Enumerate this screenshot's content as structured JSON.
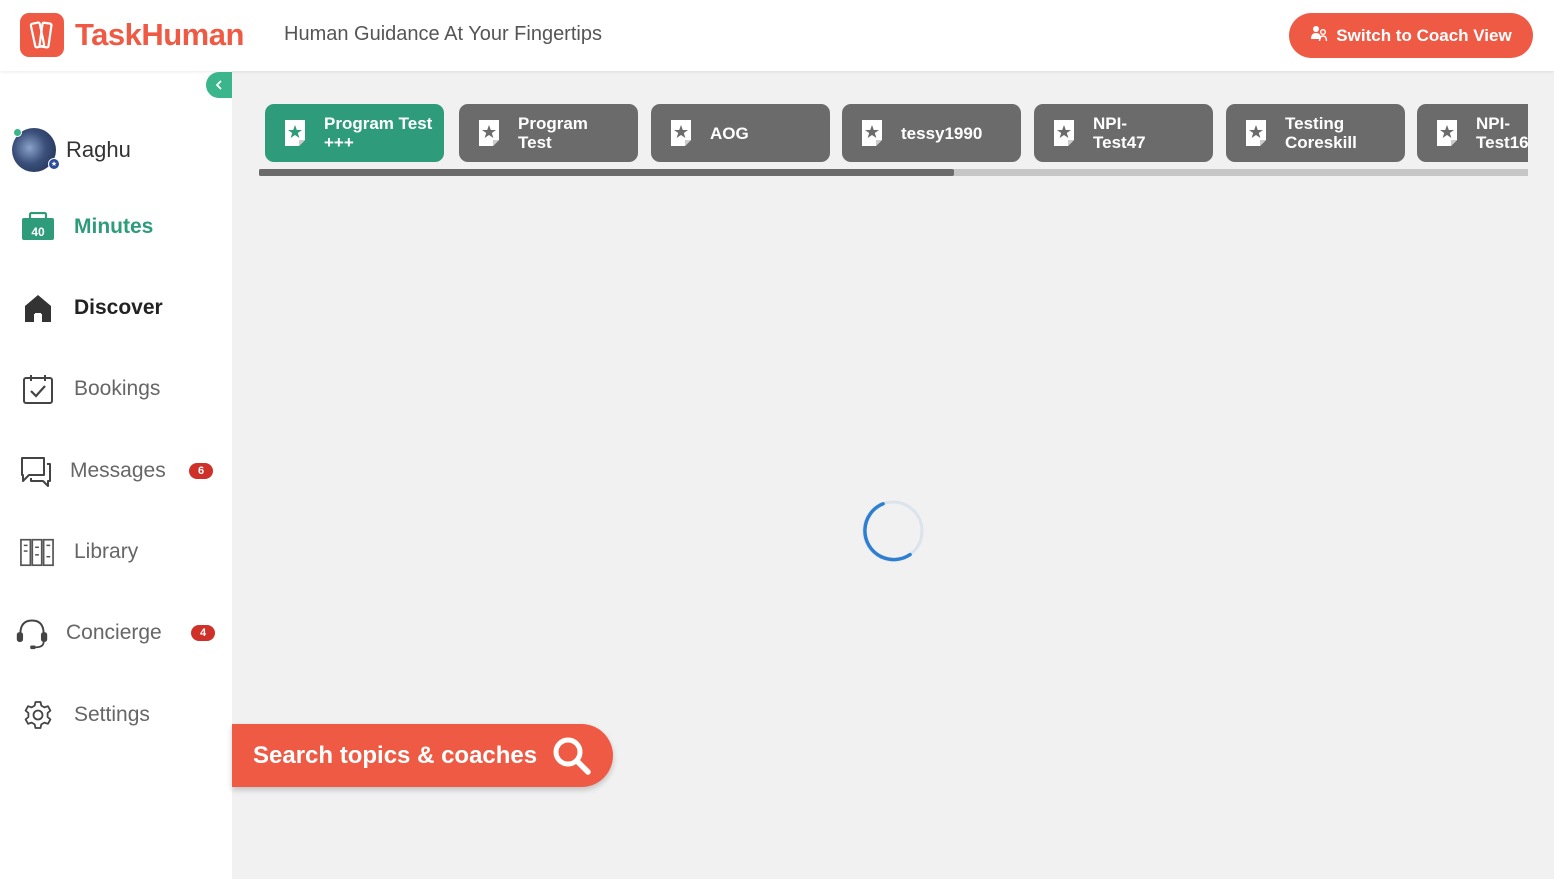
{
  "header": {
    "logo_text": "TaskHuman",
    "tagline": "Human Guidance At Your Fingertips",
    "coach_view_label": "Switch to Coach View"
  },
  "profile": {
    "name": "Raghu"
  },
  "minutes": {
    "count": "40",
    "label": "Minutes"
  },
  "sidebar": {
    "items": [
      {
        "key": "discover",
        "label": "Discover",
        "icon": "home-icon"
      },
      {
        "key": "bookings",
        "label": "Bookings",
        "icon": "calendar-check-icon"
      },
      {
        "key": "messages",
        "label": "Messages",
        "icon": "chat-icon",
        "badge": "6"
      },
      {
        "key": "library",
        "label": "Library",
        "icon": "library-icon"
      },
      {
        "key": "concierge",
        "label": "Concierge",
        "icon": "headset-icon",
        "badge": "4"
      },
      {
        "key": "settings",
        "label": "Settings",
        "icon": "gear-icon"
      }
    ]
  },
  "programs": {
    "tabs": [
      {
        "label": "Program Test\n+++",
        "active": true
      },
      {
        "label": "Program\nTest",
        "active": false
      },
      {
        "label": "AOG",
        "active": false
      },
      {
        "label": "tessy1990",
        "active": false
      },
      {
        "label": "NPI-\nTest47",
        "active": false
      },
      {
        "label": "Testing\nCoreskill",
        "active": false
      },
      {
        "label": "NPI-\nTest16",
        "active": false
      }
    ],
    "scroll_fraction": 0.548
  },
  "search": {
    "label": "Search topics & coaches"
  },
  "colors": {
    "brand": "#ef5a45",
    "accent": "#2e9c7b",
    "badge": "#d0302a",
    "tab_inactive": "#6b6b6b",
    "spinner": "#2f7fd1"
  }
}
